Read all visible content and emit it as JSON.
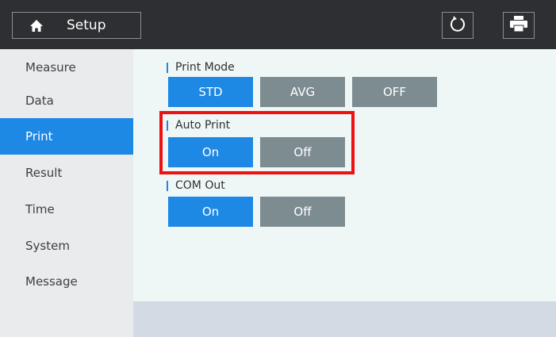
{
  "header": {
    "title": "Setup",
    "home_icon": "home-icon",
    "refresh_icon": "refresh-icon",
    "printer_icon": "printer-icon"
  },
  "sidebar": {
    "items": [
      {
        "label": "Measure",
        "active": false
      },
      {
        "label": "Data",
        "active": false
      },
      {
        "label": "Print",
        "active": true
      },
      {
        "label": "Result",
        "active": false
      },
      {
        "label": "Time",
        "active": false
      },
      {
        "label": "System",
        "active": false
      },
      {
        "label": "Message",
        "active": false
      }
    ]
  },
  "main": {
    "print_mode": {
      "label": "Print Mode",
      "options": [
        "STD",
        "AVG",
        "OFF"
      ],
      "selected": "STD"
    },
    "auto_print": {
      "label": "Auto Print",
      "options": [
        "On",
        "Off"
      ],
      "selected": "On"
    },
    "com_out": {
      "label": "COM Out",
      "options": [
        "On",
        "Off"
      ],
      "selected": "On"
    }
  },
  "colors": {
    "accent": "#1e88e5",
    "inactive_button": "#7c8c91",
    "highlight": "#ee1111",
    "topbar": "#2e2f33"
  }
}
